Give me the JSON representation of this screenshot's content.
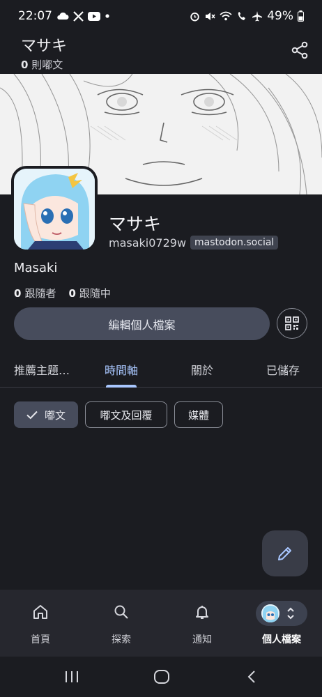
{
  "status_bar": {
    "time": "22:07",
    "battery": "49%",
    "left_icons": [
      "cloud-icon",
      "x-logo-icon",
      "youtube-icon",
      "dot-icon"
    ],
    "right_icons": [
      "alarm-icon",
      "mute-icon",
      "wifi-icon",
      "wifi-calling-icon",
      "airplane-icon",
      "battery-icon"
    ]
  },
  "appbar": {
    "title": "マサキ",
    "post_count": "0",
    "post_unit": " 則嘟文",
    "share_icon": "share-icon"
  },
  "profile": {
    "display_name": "マサキ",
    "handle": "masaki0729w",
    "server": "mastodon.social",
    "bio_name": "Masaki",
    "followers_count": "0",
    "followers_label": "跟隨者",
    "following_count": "0",
    "following_label": "跟隨中",
    "edit_button": "編輯個人檔案",
    "qr_icon": "qr-code-icon"
  },
  "tabs": [
    {
      "label": "推薦主題…",
      "active": false
    },
    {
      "label": "時間軸",
      "active": true
    },
    {
      "label": "關於",
      "active": false
    },
    {
      "label": "已儲存",
      "active": false
    }
  ],
  "filters": [
    {
      "label": "嘟文",
      "selected": true
    },
    {
      "label": "嘟文及回覆",
      "selected": false
    },
    {
      "label": "媒體",
      "selected": false
    }
  ],
  "fab_icon": "compose-pencil-icon",
  "bottom_nav": [
    {
      "label": "首頁",
      "icon": "home-icon",
      "active": false
    },
    {
      "label": "探索",
      "icon": "search-icon",
      "active": false
    },
    {
      "label": "通知",
      "icon": "bell-icon",
      "active": false
    },
    {
      "label": "個人檔案",
      "icon": "avatar-switcher-icon",
      "active": true
    }
  ],
  "system_nav": [
    "recents-icon",
    "home-circle-icon",
    "back-icon"
  ],
  "colors": {
    "background": "#1b1c21",
    "accent": "#a9c7ff",
    "button": "#474c5c",
    "nav_bar": "#26272e"
  }
}
